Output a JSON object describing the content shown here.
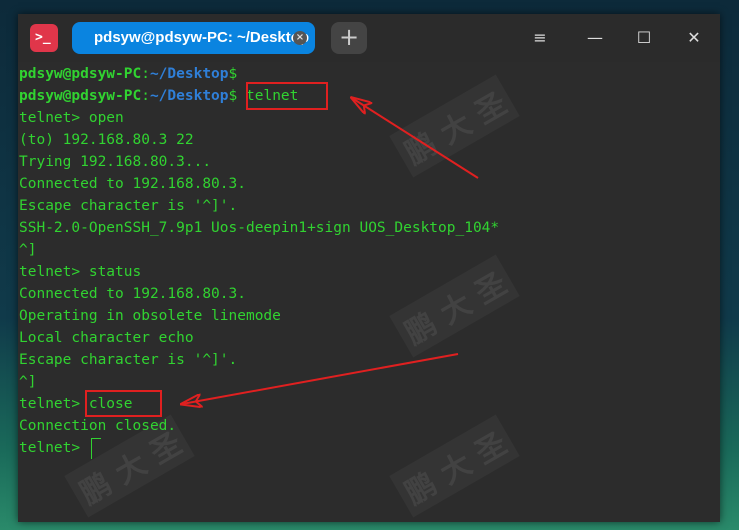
{
  "titlebar": {
    "app_icon": "terminal-icon",
    "tab_title": "pdsyw@pdsyw-PC: ~/Desktop",
    "tab_close_glyph": "×",
    "new_tab_glyph": "+",
    "minimize_glyph": "—",
    "menu_glyph": "≡",
    "maximize_glyph": "☐",
    "close_glyph": "✕"
  },
  "terminal": {
    "prompt_user": "pdsyw@pdsyw-PC",
    "prompt_colon": ":",
    "prompt_path": "~/Desktop",
    "prompt_dollar": "$",
    "lines": [
      "telnet",
      "telnet> open",
      "(to) 192.168.80.3 22",
      "Trying 192.168.80.3...",
      "Connected to 192.168.80.3.",
      "Escape character is '^]'.",
      "SSH-2.0-OpenSSH_7.9p1 Uos-deepin1+sign UOS_Desktop_104*",
      "^]",
      "telnet> status",
      "Connected to 192.168.80.3.",
      "Operating in obsolete linemode",
      "Local character echo",
      "Escape character is '^]'.",
      "^]",
      "telnet> close",
      "Connection closed.",
      "telnet> "
    ],
    "cmd_telnet": "telnet",
    "cmd_close_prefix": "telnet> ",
    "cmd_close": "close"
  },
  "colors": {
    "text_green": "#31d331",
    "path_blue": "#2f7fd8",
    "annotation_red": "#e02020",
    "tab_blue": "#0a84e0"
  },
  "watermark": "鹏 大 圣"
}
